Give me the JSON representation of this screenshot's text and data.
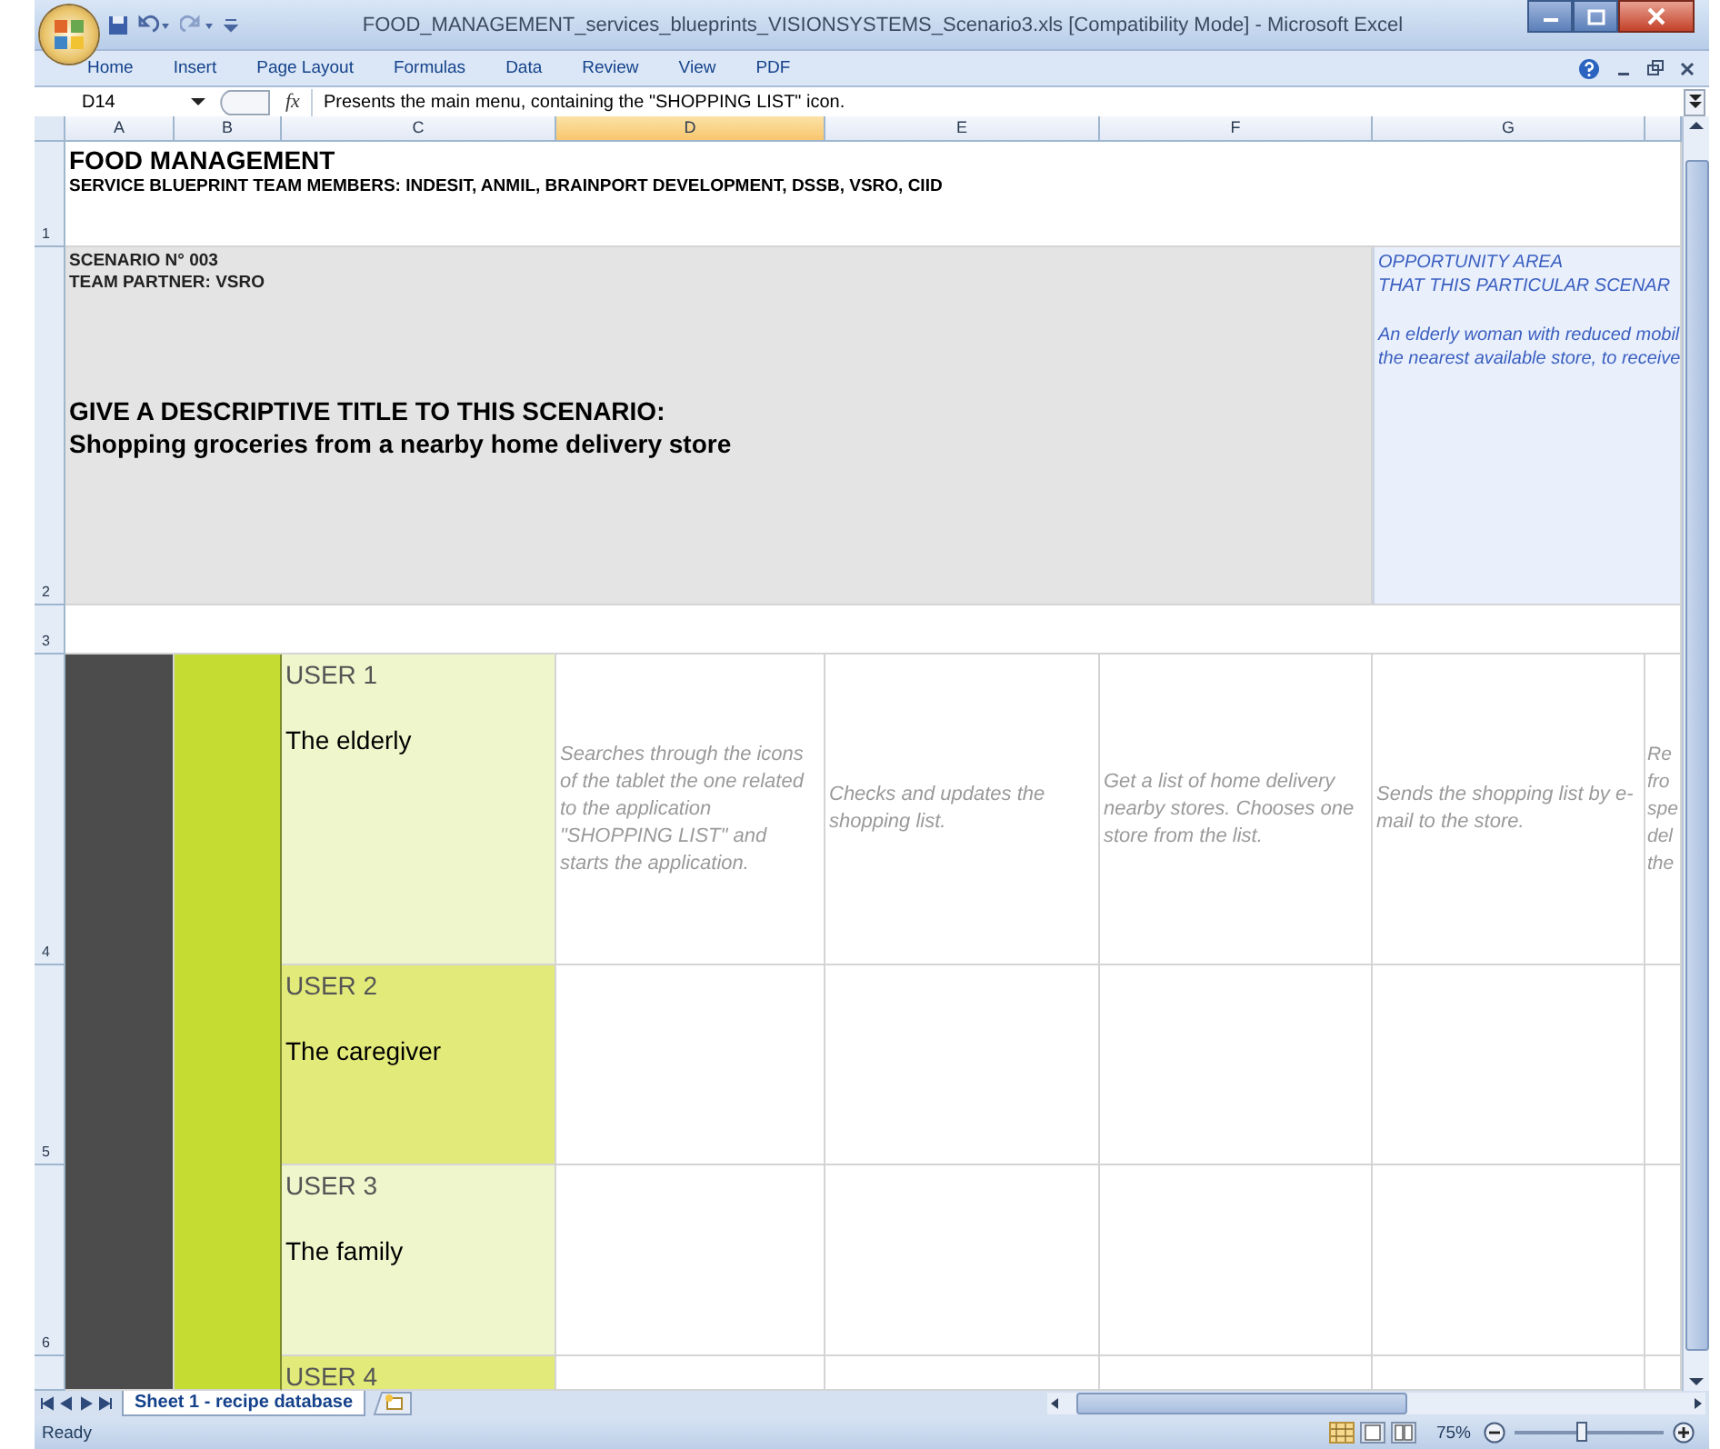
{
  "window": {
    "title": "FOOD_MANAGEMENT_services_blueprints_VISIONSYSTEMS_Scenario3.xls  [Compatibility Mode] - Microsoft Excel"
  },
  "ribbon_tabs": [
    "Home",
    "Insert",
    "Page Layout",
    "Formulas",
    "Data",
    "Review",
    "View",
    "PDF"
  ],
  "formula_bar": {
    "name_box": "D14",
    "fx": "fx",
    "content": "Presents the main menu, containing the \"SHOPPING LIST\" icon."
  },
  "columns": [
    {
      "label": "A",
      "selected": false
    },
    {
      "label": "B",
      "selected": false
    },
    {
      "label": "C",
      "selected": false
    },
    {
      "label": "D",
      "selected": true
    },
    {
      "label": "E",
      "selected": false
    },
    {
      "label": "F",
      "selected": false
    },
    {
      "label": "G",
      "selected": false
    }
  ],
  "rows": [
    "1",
    "2",
    "3",
    "4",
    "5",
    "6"
  ],
  "header": {
    "title": "FOOD MANAGEMENT",
    "team_members": "SERVICE BLUEPRINT TEAM MEMBERS: INDESIT, ANMIL, BRAINPORT DEVELOPMENT, DSSB, VSRO, CIID"
  },
  "scenario": {
    "number": "SCENARIO N° 003",
    "team_partner": "TEAM PARTNER:  VSRO",
    "prompt": "GIVE A DESCRIPTIVE TITLE TO THIS SCENARIO:",
    "title": "Shopping groceries from a nearby home delivery store"
  },
  "opportunity": {
    "heading": "OPPORTUNITY AREA\nTHAT THIS PARTICULAR SCENAR",
    "description": "An elderly woman with reduced mobil\nthe nearest available store, to receive"
  },
  "users": [
    {
      "label": "USER 1",
      "name": "The elderly",
      "color": "#f0f6cc"
    },
    {
      "label": "USER 2",
      "name": "The caregiver",
      "color": "#e2ea7a"
    },
    {
      "label": "USER 3",
      "name": "The family",
      "color": "#f0f6cc"
    },
    {
      "label": "USER 4",
      "color": "#e2ea7a"
    }
  ],
  "steps": [
    "Searches through the icons of the tablet the one related to the application \"SHOPPING LIST\" and starts the application.",
    "Checks and updates the shopping list.",
    "Get a list of home delivery nearby stores. Chooses one store from the list.",
    "Sends the shopping list by e-mail to the store.",
    "Re\nfro\nspe\ndel\nthe"
  ],
  "sheet_tabs": [
    {
      "label": "Sheet 1 - recipe database",
      "selected": true
    }
  ],
  "status_bar": {
    "text": "Ready",
    "zoom": "75%",
    "zoom_slider": {
      "level": 0.45
    }
  }
}
